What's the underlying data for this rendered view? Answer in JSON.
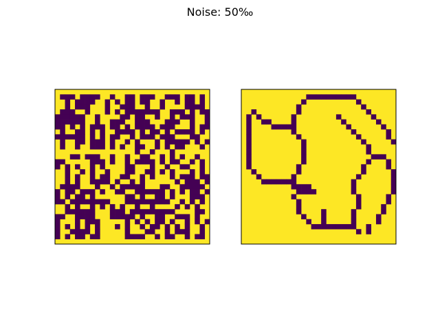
{
  "figure": {
    "suptitle": "Noise: 50‰"
  },
  "colors": {
    "low": "#440154",
    "high": "#fde725",
    "frame": "#000000"
  },
  "chart_data": [
    {
      "type": "heatmap",
      "title": "",
      "xlabel": "",
      "ylabel": "",
      "ticks": "none",
      "colormap": "viridis",
      "grid": false,
      "rows": [
        "1111111111111111111111111111111",
        "1000100001101100100011000100101",
        "1101000011010100100110110100101",
        "1101000111011000110110111100001",
        "1000110111010100000001100010100",
        "0000001101111001001101101000110",
        "0000001101100011000111000110110",
        "0010101000100101000010001110100",
        "1011001010110000101001010000101",
        "0000001010100110100010001110011",
        "1011001000101101011101000001010",
        "1011011000101011001101010011101",
        "1111111111111111011011101111111",
        "1110010001101101100110101011011",
        "0011111000101101000010100110101",
        "0101011010111100111011011001101",
        "1101101011011100110010101110101",
        "1101011010011001101011101000100",
        "1101011000010110101111110100010",
        "1000011101101000001110011000001",
        "0100100010110011000000101010010",
        "0101001011111100101100101110001",
        "0010000000011100000000011010101",
        "1101011010101011011011110101011",
        "1100000011100010000000001111001",
        "0011000011100000101100110001011",
        "0111010001111101010100101101010",
        "0101010101110101101001010101101",
        "0110000101111101110011010001101",
        "0101001001111100001101001101001",
        "1111111111111111111111111111111"
      ]
    },
    {
      "type": "heatmap",
      "title": "",
      "xlabel": "",
      "ylabel": "",
      "ticks": "none",
      "colormap": "viridis",
      "grid": false,
      "rows": [
        "1111111111111111111111111111111",
        "1111111111111000000000011111111",
        "1111111111110111111111101111111",
        "1111111111101111111111110111111",
        "1101111111101111111111111011111",
        "1010111111011111111011111101111",
        "1011001111011111111101111110111",
        "1011110000011111111110111111011",
        "1011111111011111111111011111101",
        "1011111111101111111111101111101",
        "1011111111110111111111110111110",
        "1011111111110111111111111011111",
        "1011111111110111111111111011111",
        "1011111111110111111111111100011",
        "1011111111110111111111111011101",
        "1011111111101111111111110111101",
        "1101111111101111111111110111110",
        "1110111111011111111111101111110",
        "1111000000011111111111011111110",
        "1111111111000011111111011111110",
        "1111111111100001111111011111110",
        "1111111111011111111111101111101",
        "1111111111101111111111101111101",
        "1111111111101111111111101111011",
        "1111111111101111011111011111011",
        "1111111111110111011111011110111",
        "1111111111111011011111011110111",
        "1111111111111100000000011011111",
        "1111111111111111111111101011111",
        "1111111111111111111111111111111",
        "1111111111111111111111111111111"
      ]
    }
  ]
}
